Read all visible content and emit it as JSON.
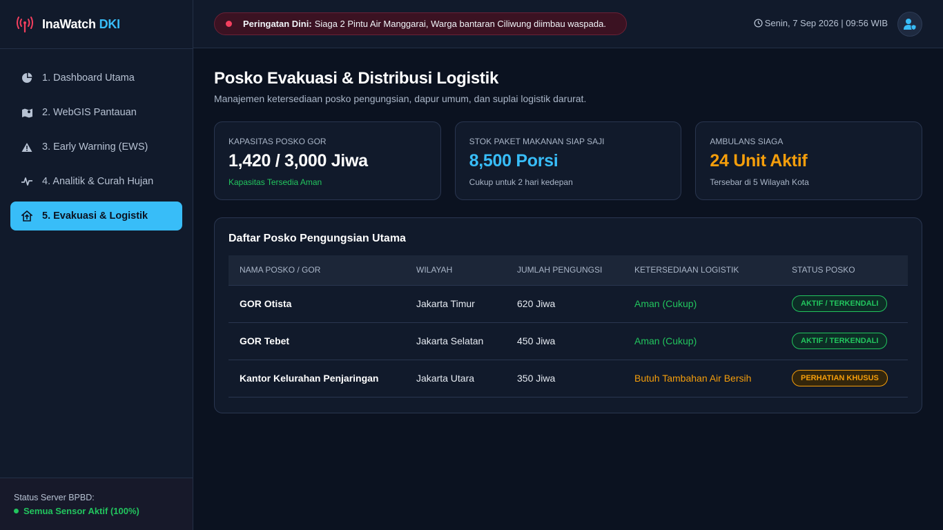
{
  "brand": {
    "name": "InaWatch",
    "accent": "DKI"
  },
  "sidebar": {
    "items": [
      {
        "label": "1. Dashboard Utama",
        "icon": "pie-chart-icon"
      },
      {
        "label": "2. WebGIS Pantauan",
        "icon": "map-icon"
      },
      {
        "label": "3. Early Warning (EWS)",
        "icon": "warning-icon"
      },
      {
        "label": "4. Analitik & Curah Hujan",
        "icon": "pulse-icon"
      },
      {
        "label": "5. Evakuasi & Logistik",
        "icon": "house-arrow-icon",
        "active": true
      }
    ],
    "server_label": "Status Server BPBD:",
    "server_value": "Semua Sensor Aktif (100%)"
  },
  "header": {
    "alert_title": "Peringatan Dini:",
    "alert_text": "Siaga 2 Pintu Air Manggarai, Warga bantaran Ciliwung diimbau waspada.",
    "datetime": "Senin, 7 Sep 2026 | 09:56 WIB"
  },
  "main": {
    "title": "Posko Evakuasi & Distribusi Logistik",
    "subtitle": "Manajemen ketersediaan posko pengungsian, dapur umum, dan suplai logistik darurat.",
    "cards": [
      {
        "label": "Kapasitas Posko GOR",
        "value": "1,420 / 3,000 Jiwa",
        "note": "Kapasitas Tersedia Aman"
      },
      {
        "label": "Stok Paket Makanan Siap Saji",
        "value": "8,500 Porsi",
        "note": "Cukup untuk 2 hari kedepan"
      },
      {
        "label": "Ambulans Siaga",
        "value": "24 Unit Aktif",
        "note": "Tersebar di 5 Wilayah Kota"
      }
    ],
    "table": {
      "title": "Daftar Posko Pengungsian Utama",
      "headers": [
        "Nama Posko / GOR",
        "Wilayah",
        "Jumlah Pengungsi",
        "Ketersediaan Logistik",
        "Status Posko"
      ],
      "rows": [
        {
          "name": "GOR Otista",
          "region": "Jakarta Timur",
          "count": "620 Jiwa",
          "logistic": "Aman (Cukup)",
          "status": "AKTIF / TERKENDALI"
        },
        {
          "name": "GOR Tebet",
          "region": "Jakarta Selatan",
          "count": "450 Jiwa",
          "logistic": "Aman (Cukup)",
          "status": "AKTIF / TERKENDALI"
        },
        {
          "name": "Kantor Kelurahan Penjaringan",
          "region": "Jakarta Utara",
          "count": "350 Jiwa",
          "logistic": "Butuh Tambahan Air Bersih",
          "status": "PERHATIAN KHUSUS"
        }
      ]
    }
  },
  "colors": {
    "accent": "#38bdf8",
    "success": "#22c55e",
    "warning": "#f59e0b",
    "danger": "#f43f5e",
    "background": "#0b1220"
  }
}
